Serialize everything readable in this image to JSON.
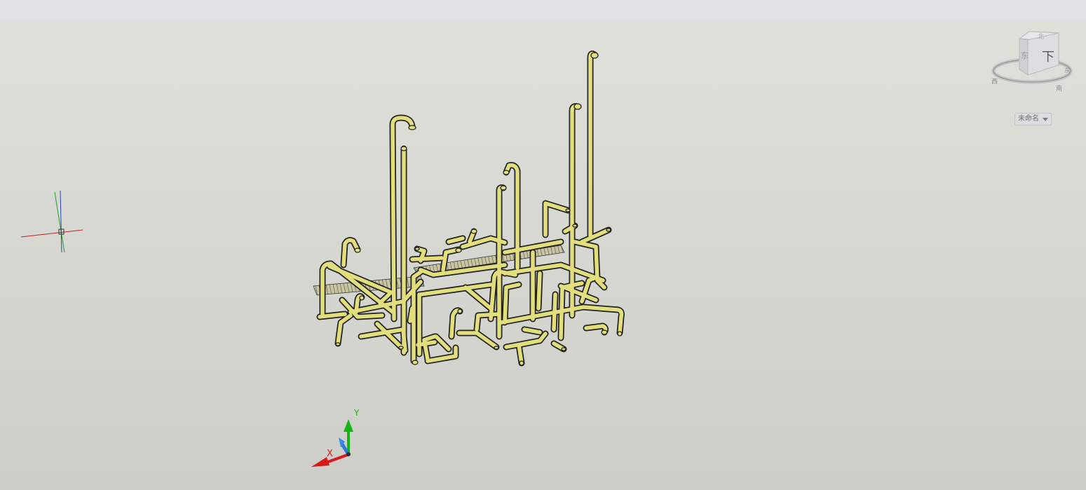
{
  "viewcube": {
    "face_label": "下",
    "side_label": "东",
    "top_label": "北",
    "compass_west": "西",
    "compass_south": "南",
    "compass_east": "东",
    "named_view": "未命名"
  },
  "ucs": {
    "x_label": "X",
    "y_label": "Y"
  },
  "colors": {
    "background_top": "#dfe0da",
    "background_bottom": "#cdcec8",
    "pipe": "#e2de7c",
    "pipe_outline": "#222222",
    "axis_x": "#d81a1a",
    "axis_y": "#16b316",
    "axis_z": "#2e7ad8"
  },
  "icons": {
    "viewcube": "viewcube-icon",
    "crosshair": "crosshair-cursor-icon",
    "ucs": "ucs-axes-icon"
  }
}
